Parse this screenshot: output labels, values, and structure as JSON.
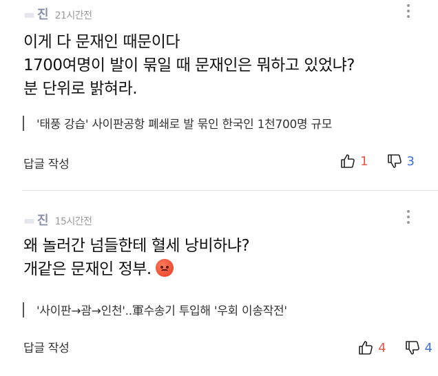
{
  "comments": [
    {
      "author": "진",
      "time": "21시간전",
      "lines": [
        "이게 다 문재인 때문이다",
        "1700여명이 발이 묶일 때 문재인은 뭐하고 있었냐?",
        "분 단위로 밝혀라."
      ],
      "emoji": "",
      "news_title": "'태풍 강습' 사이판공항 폐쇄로 발 묶인 한국인 1천700명 규모",
      "reply_label": "답글 작성",
      "likes": "1",
      "dislikes": "3"
    },
    {
      "author": "진",
      "time": "15시간전",
      "lines": [
        "왜 놀러간 넘들한테 혈세 낭비하냐?",
        "개같은 문재인 정부."
      ],
      "emoji": "angry-face-icon",
      "news_title": "'사이판→괌→인천'..軍수송기 투입해 '우회 이송작전'",
      "reply_label": "답글 작성",
      "likes": "4",
      "dislikes": "4"
    }
  ],
  "colors": {
    "like": "#e05a4a",
    "dislike": "#3f6fd8",
    "author": "#8a8fa8"
  }
}
